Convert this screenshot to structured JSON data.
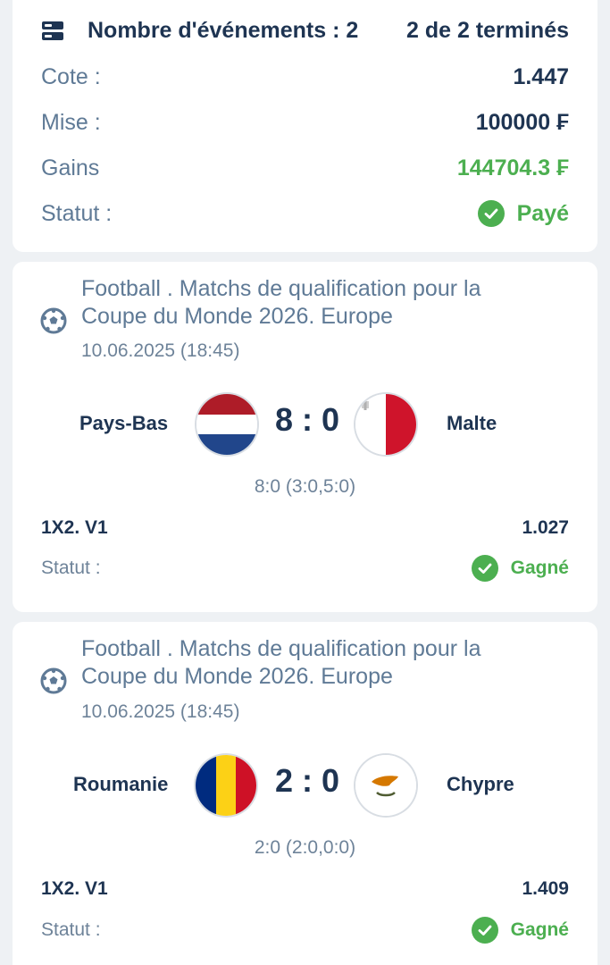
{
  "summary": {
    "events_label": "Nombre d'événements : 2",
    "completed": "2 de 2 terminés",
    "rows": [
      {
        "label": "Cote :",
        "value": "1.447"
      },
      {
        "label": "Mise :",
        "value": "100000 ₣"
      },
      {
        "label": "Gains",
        "value": "144704.3 ₣"
      },
      {
        "label": "Statut :",
        "value": "Payé"
      }
    ],
    "colors": {
      "accent_green": "#4caf50",
      "text_dark": "#1e3452"
    }
  },
  "events": [
    {
      "league_line1": "Football . Matchs de qualification pour la",
      "league_line2": "Coupe du Monde 2026. Europe",
      "date": "10.06.2025 (18:45)",
      "home": "Pays-Bas",
      "away": "Malte",
      "score": "8 : 0",
      "score_detail": "8:0 (3:0,5:0)",
      "market": "1X2. V1",
      "odds": "1.027",
      "status_label": "Statut :",
      "status": "Gagné",
      "home_flag": "netherlands-flag-icon",
      "away_flag": "malta-flag-icon"
    },
    {
      "league_line1": "Football . Matchs de qualification pour la",
      "league_line2": "Coupe du Monde 2026. Europe",
      "date": "10.06.2025 (18:45)",
      "home": "Roumanie",
      "away": "Chypre",
      "score": "2 : 0",
      "score_detail": "2:0 (2:0,0:0)",
      "market": "1X2. V1",
      "odds": "1.409",
      "status_label": "Statut :",
      "status": "Gagné",
      "home_flag": "romania-flag-icon",
      "away_flag": "cyprus-flag-icon"
    }
  ]
}
